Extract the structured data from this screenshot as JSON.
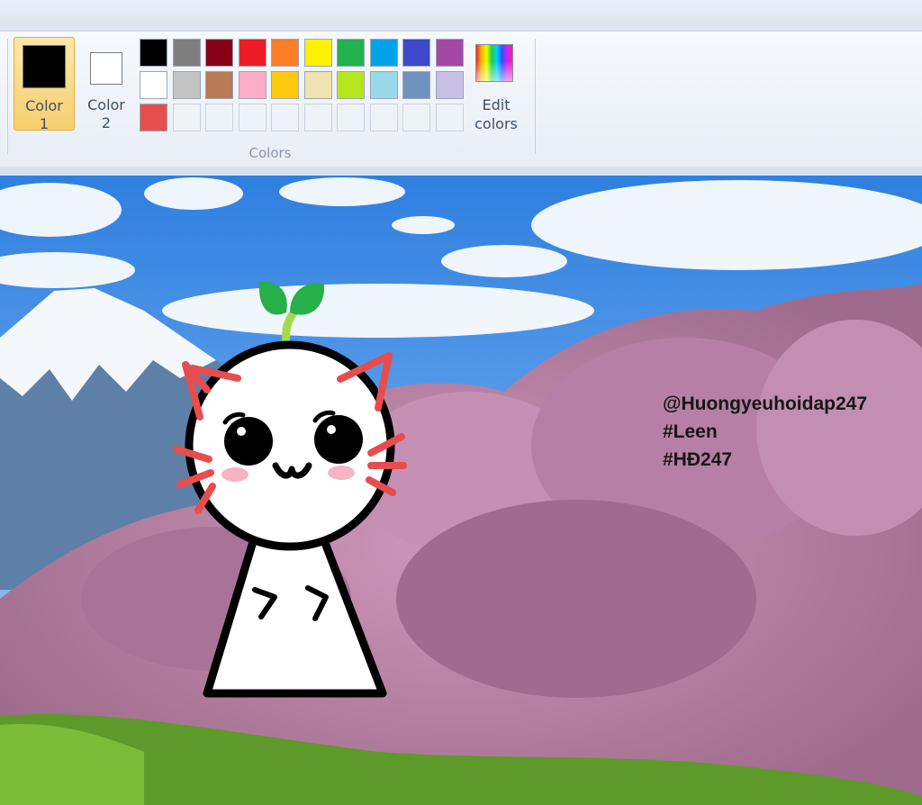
{
  "toolbar": {
    "color1_label": "Color\n1",
    "color2_label": "Color\n2",
    "color1_value": "#000000",
    "color2_value": "#ffffff",
    "edit_colors_label": "Edit\ncolors",
    "group_label": "Colors"
  },
  "palette": {
    "row1": [
      "#000000",
      "#7f7f7f",
      "#880015",
      "#ed1c24",
      "#ff7f27",
      "#fff200",
      "#22b14c",
      "#00a2e8",
      "#3f48cc",
      "#a349a4"
    ],
    "row2": [
      "#ffffff",
      "#c3c3c3",
      "#b97a57",
      "#ffaec9",
      "#ffc90e",
      "#efe4b0",
      "#b5e61d",
      "#99d9ea",
      "#7092be",
      "#c8bfe7"
    ],
    "row3": [
      "#e84d4d",
      "",
      "",
      "",
      "",
      "",
      "",
      "",
      "",
      ""
    ]
  },
  "canvas_text": {
    "line1": "@Huongyeuhoidap247",
    "line2": "#Leen",
    "line3": "#HĐ247"
  }
}
